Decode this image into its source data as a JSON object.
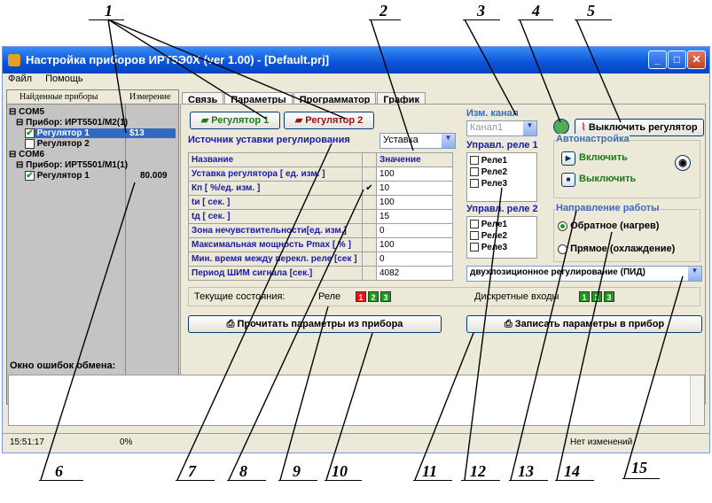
{
  "callouts": [
    "1",
    "2",
    "3",
    "4",
    "5",
    "6",
    "7",
    "8",
    "9",
    "10",
    "11",
    "12",
    "13",
    "14",
    "15"
  ],
  "window": {
    "title": "Настройка приборов ИРТ5Э0Х (ver 1.00) - [Default.prj]",
    "menu": [
      "Файл",
      "Помощь"
    ]
  },
  "left_pane": {
    "col1": "Найденные приборы",
    "col2": "Измерение",
    "tree": [
      {
        "label": "COM5"
      },
      {
        "label": "Прибор: ИРТ5501/М2(1)"
      },
      {
        "label": "Регулятор 1",
        "value": "$13",
        "checked": true,
        "selected": true
      },
      {
        "label": "Регулятор 2",
        "value": "",
        "checked": false
      },
      {
        "label": "COM6"
      },
      {
        "label": "Прибор: ИРТ5501/М1(1)"
      },
      {
        "label": "Регулятор 1",
        "value": "80.009",
        "checked": true
      }
    ]
  },
  "tabs": [
    "Связь",
    "Параметры",
    "Программатор",
    "График"
  ],
  "regulators": [
    "Регулятор 1",
    "Регулятор 2"
  ],
  "setpoint": {
    "label": "Источник уставки регулирования",
    "value": "Уставка"
  },
  "params": {
    "headers": [
      "Название",
      "Значение"
    ],
    "rows": [
      {
        "name": "Уставка регулятора [ ед. изм. ]",
        "value": "100"
      },
      {
        "name": "Кп [ %/ед. изм. ]",
        "value": "10",
        "checked": true
      },
      {
        "name": "tи [ сек. ]",
        "value": "100"
      },
      {
        "name": "tд [ сек. ]",
        "value": "15"
      },
      {
        "name": "Зона нечувствительности[ед. изм.]",
        "value": "0"
      },
      {
        "name": "Максимальная мощность Pmax [ % ]",
        "value": "100"
      },
      {
        "name": "Мин. время между перекл. реле [сек ]",
        "value": "0"
      },
      {
        "name": "Период ШИМ сигнала [сек.]",
        "value": "4082"
      }
    ]
  },
  "meas_channel": {
    "label": "Изм. канал",
    "value": "Канал1"
  },
  "relay1": {
    "label": "Управл. реле 1",
    "items": [
      "Реле1",
      "Реле2",
      "Реле3"
    ]
  },
  "relay2": {
    "label": "Управл. реле 2",
    "items": [
      "Реле1",
      "Реле2",
      "Реле3"
    ]
  },
  "disable_button": "Выключить регулятор",
  "autotune": {
    "label": "Автонастройка",
    "on": "Включить",
    "off": "Выключить"
  },
  "direction": {
    "label": "Направление работы",
    "options": [
      "Обратное (нагрев)",
      "Прямое (охлаждение)"
    ],
    "selected": 0
  },
  "mode": "двухпозиционное регулирование (ПИД)",
  "status": {
    "current": "Текущие состояния:",
    "relay_label": "Реле",
    "relays": [
      "1",
      "2",
      "3"
    ],
    "discrete_label": "Дискретные входы",
    "inputs": [
      "1",
      "2",
      "3"
    ]
  },
  "read_button": "Прочитать параметры из прибора",
  "write_button": "Записать параметры в прибор",
  "error_log": {
    "label": "Окно ошибок обмена:"
  },
  "statusbar": {
    "time": "15:51:17",
    "progress": "0%",
    "state": "Нет изменений"
  }
}
